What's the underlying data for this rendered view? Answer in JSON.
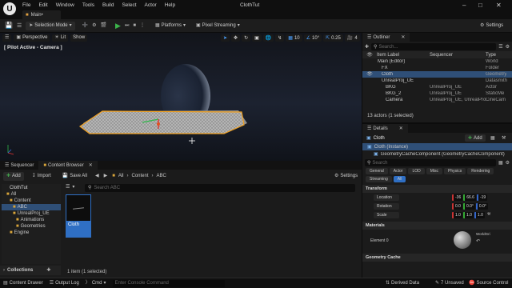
{
  "title_bar": {
    "menus": [
      "File",
      "Edit",
      "Window",
      "Tools",
      "Build",
      "Select",
      "Actor",
      "Help"
    ],
    "project_tab": "Main•",
    "window_title": "ClothTut"
  },
  "toolbar": {
    "selection_mode": "Selection Mode",
    "platforms": "Platforms",
    "pixel_streaming": "Pixel Streaming",
    "settings": "Settings"
  },
  "viewport": {
    "perspective": "Perspective",
    "lit": "Lit",
    "show": "Show",
    "pilot_label": "[ Pilot Active - Camera ]",
    "grid_snap": "10",
    "rot_snap": "10°",
    "scale_snap": "0.25",
    "cam_speed": "4"
  },
  "lower_tabs": {
    "sequencer": "Sequencer",
    "content_browser": "Content Browser"
  },
  "content_browser": {
    "add": "Add",
    "import": "Import",
    "save_all": "Save All",
    "path": [
      "All",
      "Content",
      "ABC"
    ],
    "settings": "Settings",
    "search_placeholder": "Search ABC",
    "tree_root": "ClothTut",
    "tree": [
      {
        "label": "All",
        "indent": 1
      },
      {
        "label": "Content",
        "indent": 2
      },
      {
        "label": "ABC",
        "indent": 3,
        "selected": true
      },
      {
        "label": "UnrealProj_UE",
        "indent": 3
      },
      {
        "label": "Animations",
        "indent": 4
      },
      {
        "label": "Geometries",
        "indent": 4
      },
      {
        "label": "Engine",
        "indent": 2
      }
    ],
    "asset_name": "Cloth",
    "status": "1 item (1 selected)",
    "collections": "Collections"
  },
  "outliner": {
    "title": "Outliner",
    "search_placeholder": "Search...",
    "columns": [
      "Item Label",
      "Sequencer",
      "Type"
    ],
    "rows": [
      {
        "label": "Main (Editor)",
        "seq": "",
        "type": "World",
        "indent": 1,
        "selected": false
      },
      {
        "label": "FX",
        "seq": "",
        "type": "Folder",
        "indent": 2,
        "selected": false
      },
      {
        "label": "Cloth",
        "seq": "",
        "type": "Geometry",
        "indent": 2,
        "selected": true
      },
      {
        "label": "UnrealProj_UE",
        "seq": "",
        "type": "Datasmith",
        "indent": 2,
        "selected": false
      },
      {
        "label": "BKG",
        "seq": "UnrealProj_UE",
        "type": "Actor",
        "indent": 3,
        "selected": false
      },
      {
        "label": "BKG_2",
        "seq": "UnrealProj_UE",
        "type": "StaticMe",
        "indent": 3,
        "selected": false
      },
      {
        "label": "Camera",
        "seq": "UnrealProj_UE, UnrealProj",
        "type": "CineCam",
        "indent": 3,
        "selected": false
      }
    ],
    "status": "13 actors (1 selected)"
  },
  "details": {
    "title": "Details",
    "actor_name": "Cloth",
    "add": "Add",
    "components": [
      "Cloth (Instance)",
      "GeometryCacheComponent (GeometryCacheComponent)"
    ],
    "search_placeholder": "Search",
    "filters": [
      "General",
      "Actor",
      "LOD",
      "Misc",
      "Physics",
      "Rendering",
      "Streaming",
      "All"
    ],
    "active_filter": "All",
    "transform_section": "Transform",
    "location_label": "Location",
    "location": [
      "-36",
      "66.6",
      "-19"
    ],
    "rotation_label": "Rotation",
    "rotation": [
      "0.0",
      "0.0°",
      "0.0°"
    ],
    "scale_label": "Scale",
    "scale": [
      "1.0",
      "1.0",
      "1.0"
    ],
    "materials_section": "Materials",
    "element0_label": "Element 0",
    "material_name": "WorldGri",
    "geometry_cache_section": "Geometry Cache"
  },
  "status_bar": {
    "content_drawer": "Content Drawer",
    "output_log": "Output Log",
    "cmd": "Cmd",
    "console_placeholder": "Enter Console Command",
    "derived_data": "Derived Data",
    "unsaved": "7 Unsaved",
    "source_control": "Source Control"
  },
  "colors": {
    "accent_blue": "#2f6fc4",
    "selection_blue": "#2f4f77",
    "play_green": "#3cb44b",
    "add_green": "#44a04c",
    "selection_outline": "#f0a020"
  }
}
